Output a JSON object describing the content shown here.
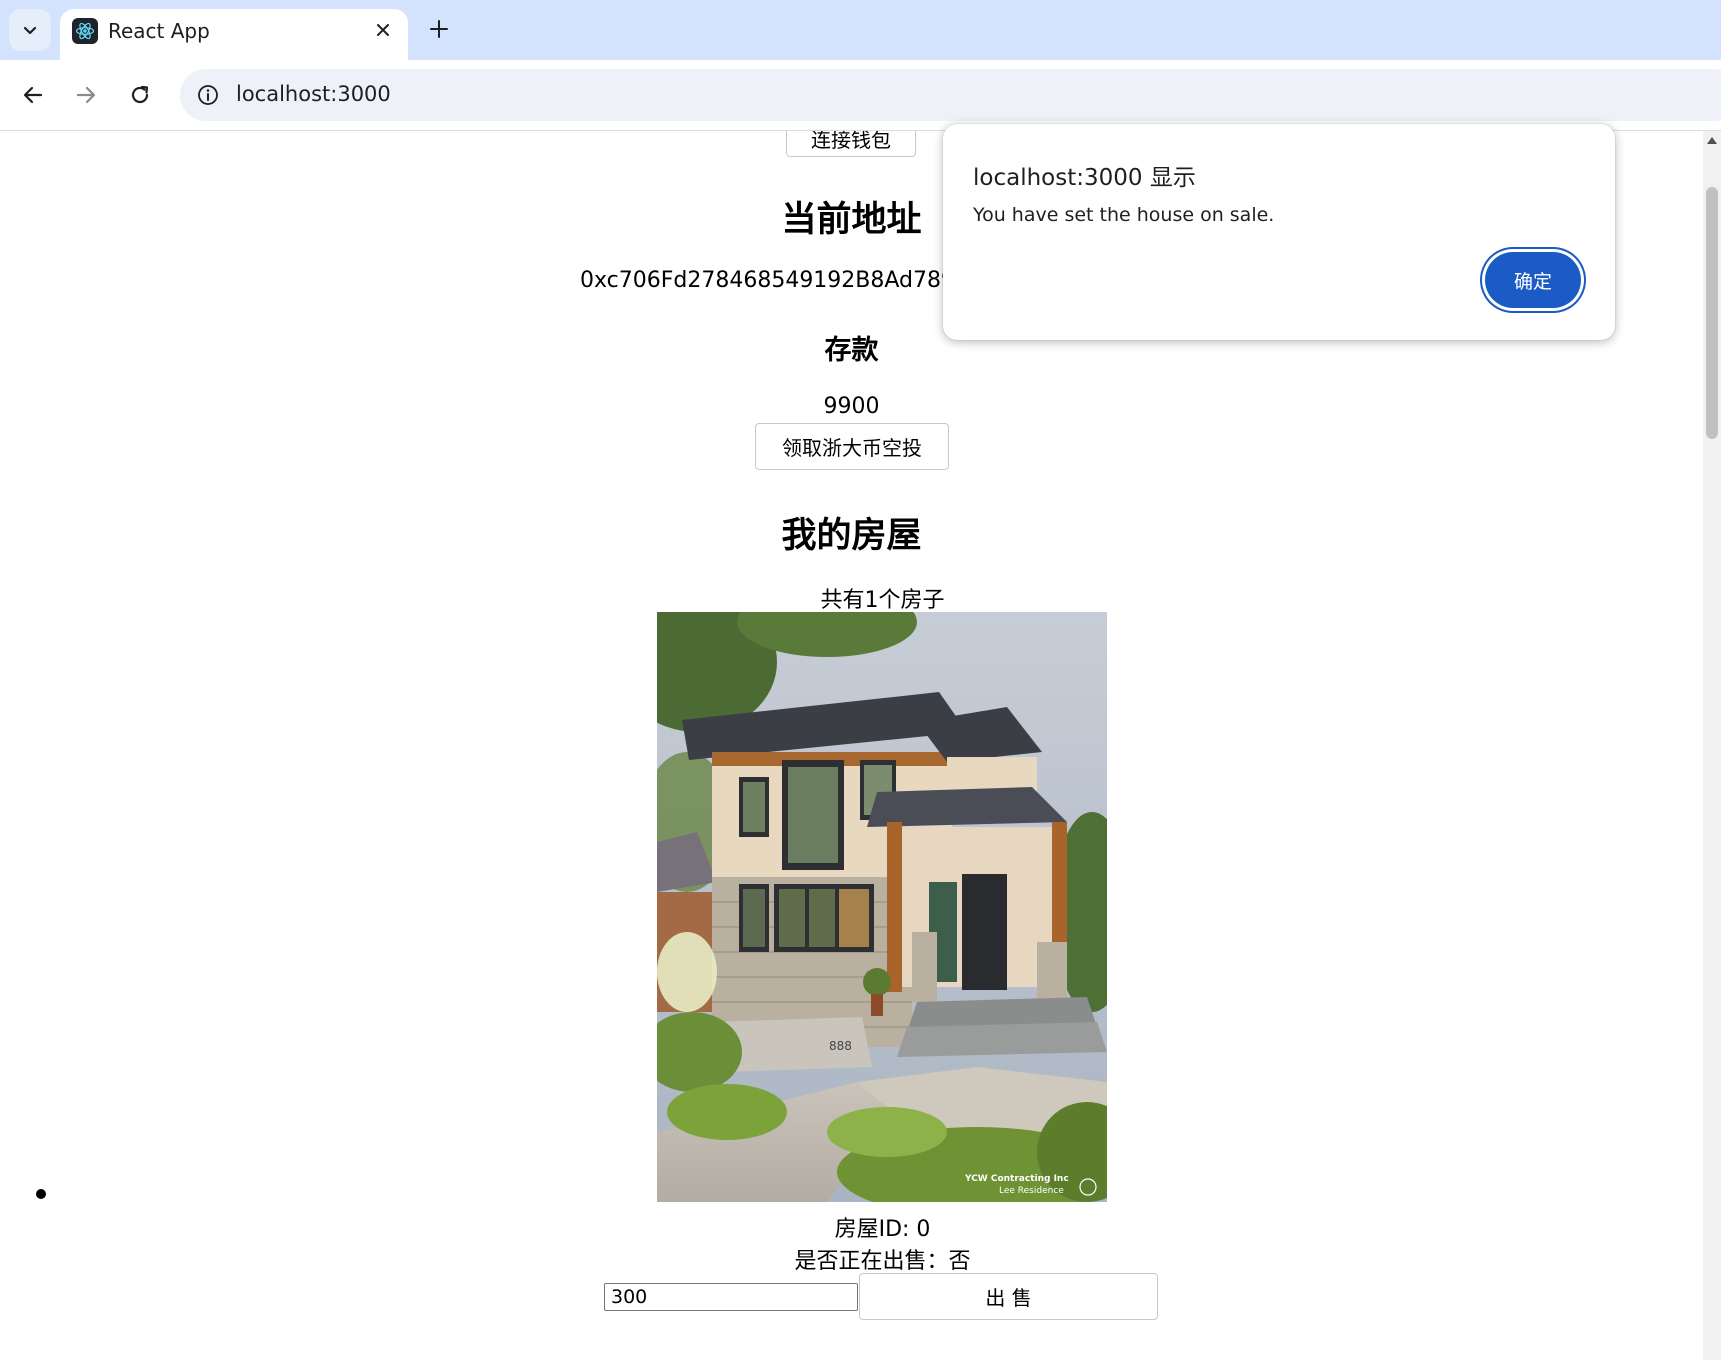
{
  "browser": {
    "tab_title": "React App",
    "url": "localhost:3000"
  },
  "page": {
    "connect_button": "连接钱包",
    "address_heading": "当前地址",
    "address_value": "0xc706Fd278468549192B8Ad7893",
    "deposit_heading": "存款",
    "deposit_value": "9900",
    "airdrop_button": "领取浙大币空投",
    "houses_heading": "我的房屋",
    "house_count": "共有1个房子",
    "house": {
      "id_text": "房屋ID: 0",
      "on_sale_text": "是否正在出售：否",
      "price_value": "300",
      "sell_button": "出 售",
      "image_watermark": "YCW Contracting Inc",
      "image_caption": "Lee Residence",
      "house_number": "888"
    }
  },
  "dialog": {
    "title": "localhost:3000 显示",
    "message": "You have set the house on sale.",
    "ok_button": "确定"
  },
  "colors": {
    "tabbar_bg": "#d3e3fd",
    "dialog_button": "#1a5bc5"
  }
}
